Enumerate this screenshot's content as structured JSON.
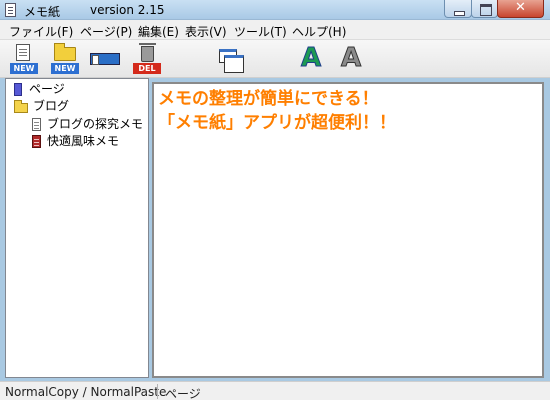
{
  "window": {
    "title": "メモ紙",
    "version": "version 2.15"
  },
  "menu": [
    "ファイル(F)",
    "ページ(P)",
    "編集(E)",
    "表示(V)",
    "ツール(T)",
    "ヘルプ(H)"
  ],
  "toolbar": {
    "new_page_badge": "NEW",
    "new_folder_badge": "NEW",
    "delete_badge": "DEL",
    "icons": [
      "new-page-icon",
      "new-folder-icon",
      "rename-icon",
      "delete-icon",
      "windows-icon",
      "font-color-icon",
      "font-icon"
    ],
    "font_color_glyph": "A",
    "font_glyph": "A"
  },
  "tree": {
    "items": [
      {
        "label": "ページ",
        "icon": "page-icon"
      },
      {
        "label": "ブログ",
        "icon": "folder-icon"
      },
      {
        "label": "ブログの探究メモ",
        "icon": "memo-icon"
      },
      {
        "label": "快適風味メモ",
        "icon": "memo-red-icon"
      }
    ]
  },
  "editor": {
    "lines": [
      "メモの整理が簡単にできる！",
      "「メモ紙」アプリが超便利！！"
    ],
    "text_color": "#ff7f00"
  },
  "status": {
    "left": "NormalCopy / NormalPaste",
    "right": "ページ"
  }
}
